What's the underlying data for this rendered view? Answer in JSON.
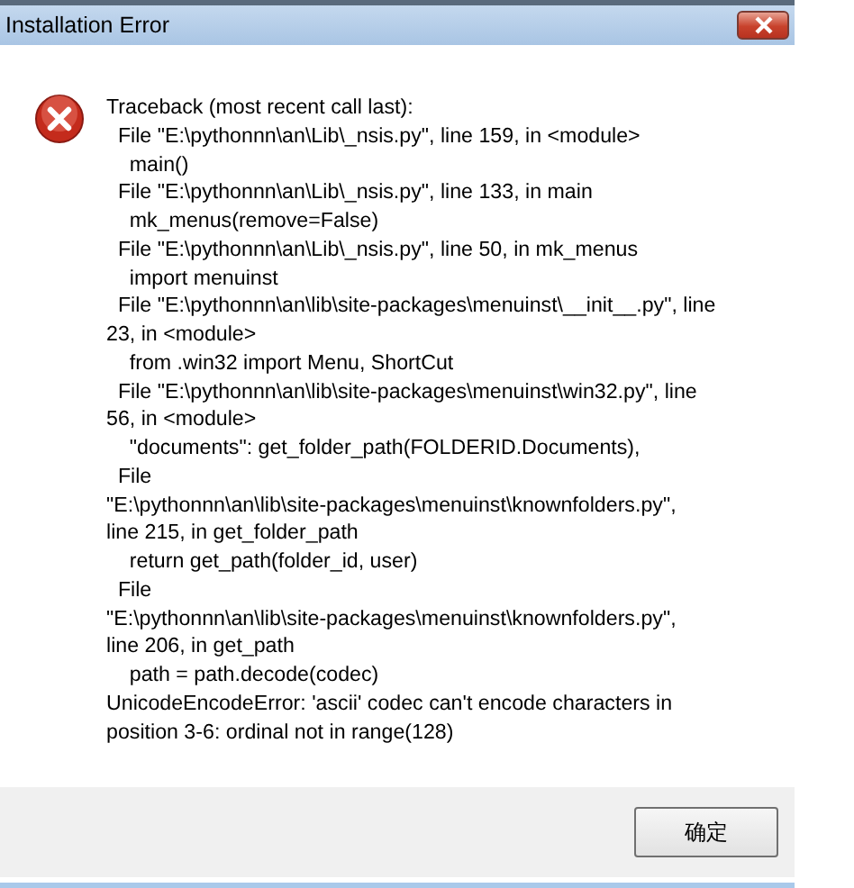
{
  "window": {
    "title": "Installation Error"
  },
  "message_lines": [
    "Traceback (most recent call last):",
    "  File \"E:\\pythonnn\\an\\Lib\\_nsis.py\", line 159, in <module>",
    "    main()",
    "  File \"E:\\pythonnn\\an\\Lib\\_nsis.py\", line 133, in main",
    "    mk_menus(remove=False)",
    "  File \"E:\\pythonnn\\an\\Lib\\_nsis.py\", line 50, in mk_menus",
    "    import menuinst",
    "  File \"E:\\pythonnn\\an\\lib\\site-packages\\menuinst\\__init__.py\", line",
    "23, in <module>",
    "    from .win32 import Menu, ShortCut",
    "  File \"E:\\pythonnn\\an\\lib\\site-packages\\menuinst\\win32.py\", line",
    "56, in <module>",
    "    \"documents\": get_folder_path(FOLDERID.Documents),",
    "  File",
    "\"E:\\pythonnn\\an\\lib\\site-packages\\menuinst\\knownfolders.py\",",
    "line 215, in get_folder_path",
    "    return get_path(folder_id, user)",
    "  File",
    "\"E:\\pythonnn\\an\\lib\\site-packages\\menuinst\\knownfolders.py\",",
    "line 206, in get_path",
    "    path = path.decode(codec)",
    "UnicodeEncodeError: 'ascii' codec can't encode characters in",
    "position 3-6: ordinal not in range(128)"
  ],
  "buttons": [
    "确定"
  ]
}
